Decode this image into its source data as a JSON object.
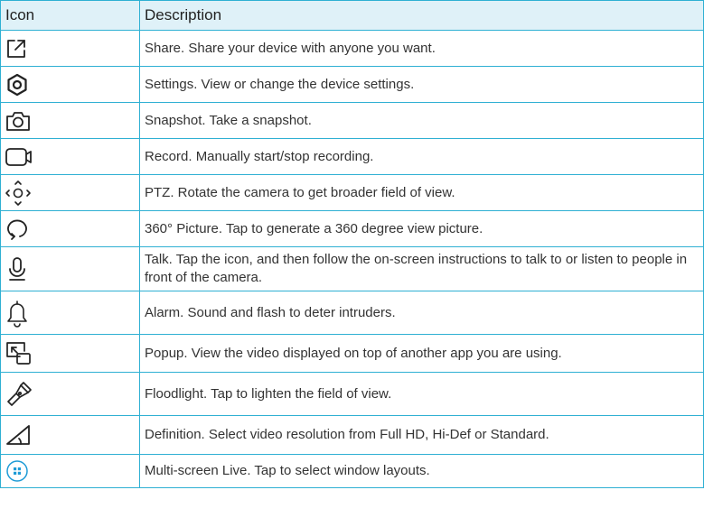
{
  "table": {
    "headers": [
      "Icon",
      "Description"
    ],
    "rows": [
      {
        "icon": "share-icon",
        "text": "Share. Share your device with anyone you want."
      },
      {
        "icon": "settings-icon",
        "text": "Settings. View or change the device settings."
      },
      {
        "icon": "snapshot-icon",
        "text": "Snapshot. Take a snapshot."
      },
      {
        "icon": "record-icon",
        "text": "Record. Manually start/stop recording."
      },
      {
        "icon": "ptz-icon",
        "text": "PTZ. Rotate the camera to get broader field of view."
      },
      {
        "icon": "picture-360-icon",
        "text": "360° Picture. Tap to generate a 360 degree view picture."
      },
      {
        "icon": "microphone-icon",
        "text": "Talk. Tap the icon, and then follow the on-screen instructions to talk to or listen to people in front of the camera."
      },
      {
        "icon": "bell-icon",
        "text": "Alarm. Sound and flash to deter intruders."
      },
      {
        "icon": "popup-icon",
        "text": "Popup. View the video displayed on top of another app you are using."
      },
      {
        "icon": "flashlight-icon",
        "text": "Floodlight. Tap to lighten the field of view."
      },
      {
        "icon": "definition-icon",
        "text": "Definition. Select video resolution from Full HD, Hi-Def or Standard."
      },
      {
        "icon": "multi-screen-icon",
        "text": "Multi-screen Live. Tap to select window layouts."
      }
    ]
  },
  "colors": {
    "border": "#2fb0d3",
    "header_bg": "#dff1f8",
    "accent": "#1e9bd6"
  }
}
